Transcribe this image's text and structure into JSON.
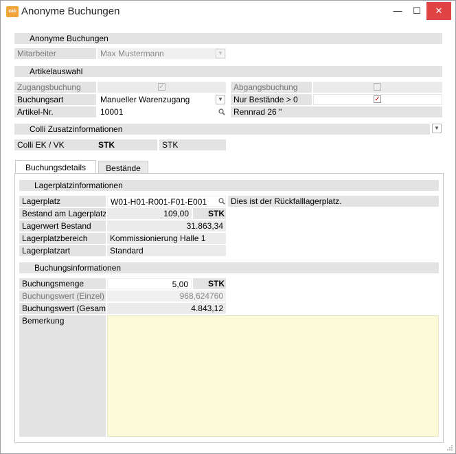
{
  "window": {
    "title": "Anonyme Buchungen",
    "app_icon_text": "cab",
    "minimize_glyph": "—",
    "maximize_glyph": "☐",
    "close_glyph": "✕"
  },
  "sections": {
    "anonyme_buchungen": "Anonyme Buchungen",
    "artikelauswahl": "Artikelauswahl",
    "colli": "Colli Zusatzinformationen",
    "lagerplatzinfo": "Lagerplatzinformationen",
    "buchungsinfo": "Buchungsinformationen"
  },
  "mitarbeiter": {
    "label": "Mitarbeiter",
    "value": "Max Mustermann"
  },
  "artikel": {
    "zugangsbuchung_label": "Zugangsbuchung",
    "zugangsbuchung_checked": true,
    "abgangsbuchung_label": "Abgangsbuchung",
    "abgangsbuchung_checked": false,
    "buchungsart_label": "Buchungsart",
    "buchungsart_value": "Manueller Warenzugang",
    "nur_bestaende_label": "Nur Bestände > 0",
    "nur_bestaende_checked": true,
    "artikelnr_label": "Artikel-Nr.",
    "artikelnr_value": "10001",
    "artikel_name": "Rennrad 26 \""
  },
  "colli": {
    "label": "Colli EK / VK",
    "ek_unit": "STK",
    "vk_unit": "STK"
  },
  "tabs": [
    {
      "label": "Buchungsdetails",
      "active": true
    },
    {
      "label": "Bestände",
      "active": false
    }
  ],
  "lager": {
    "lagerplatz_label": "Lagerplatz",
    "lagerplatz_value": "W01-H01-R001-F01-E001",
    "lagerplatz_hint": "Dies ist der Rückfalllagerplatz.",
    "bestand_label": "Bestand am Lagerplatz",
    "bestand_value": "109,00",
    "bestand_unit": "STK",
    "lagerwert_label": "Lagerwert Bestand",
    "lagerwert_value": "31.863,34",
    "bereich_label": "Lagerplatzbereich",
    "bereich_value": "Kommissionierung Halle 1",
    "art_label": "Lagerplatzart",
    "art_value": "Standard"
  },
  "buchung": {
    "menge_label": "Buchungsmenge",
    "menge_value": "5,00",
    "menge_unit": "STK",
    "wert_einzel_label": "Buchungswert (Einzel)",
    "wert_einzel_value": "968,624760",
    "wert_gesamt_label": "Buchungswert (Gesamt)",
    "wert_gesamt_value": "4.843,12",
    "bemerkung_label": "Bemerkung",
    "bemerkung_value": ""
  }
}
